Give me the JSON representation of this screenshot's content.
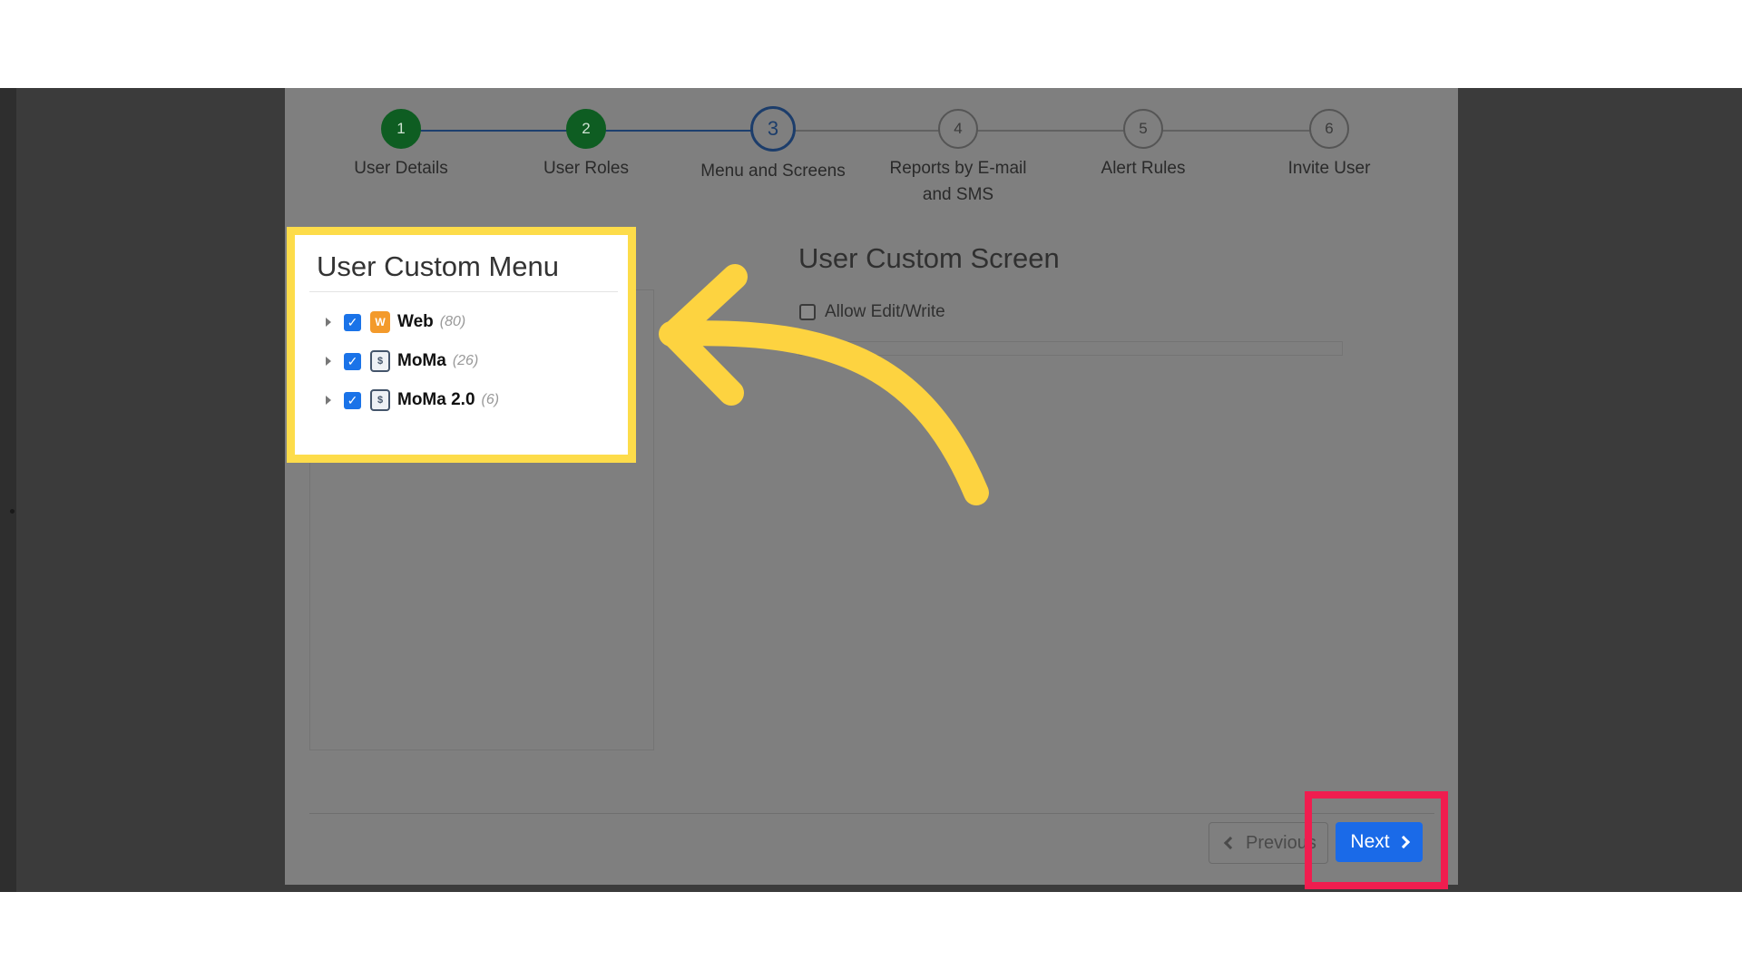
{
  "stepper": {
    "steps": [
      {
        "number": "1",
        "label": "User Details",
        "state": "done"
      },
      {
        "number": "2",
        "label": "User Roles",
        "state": "done"
      },
      {
        "number": "3",
        "label": "Menu and Screens",
        "state": "active"
      },
      {
        "number": "4",
        "label": "Reports by E-mail and SMS",
        "state": "pending"
      },
      {
        "number": "5",
        "label": "Alert Rules",
        "state": "pending"
      },
      {
        "number": "6",
        "label": "Invite User",
        "state": "pending"
      }
    ]
  },
  "menu": {
    "title": "User Custom Menu",
    "items": [
      {
        "name": "Web",
        "count": "(80)",
        "checked": true,
        "icon": "web-app-icon"
      },
      {
        "name": "MoMa",
        "count": "(26)",
        "checked": true,
        "icon": "mobile-app-icon"
      },
      {
        "name": "MoMa 2.0",
        "count": "(6)",
        "checked": true,
        "icon": "mobile-app-icon"
      }
    ]
  },
  "screen": {
    "title": "User Custom Screen",
    "allow_label": "Allow Edit/Write",
    "allow_checked": false
  },
  "footer": {
    "previous_label": "Previous",
    "next_label": "Next"
  },
  "colors": {
    "overlay_dialog": "#7f7f7f",
    "step_done": "#0e5d22",
    "step_active": "#1c3d6b",
    "checkbox": "#1a73e8",
    "next_button": "#1a6ae8",
    "highlight_yellow": "#fddc4a",
    "highlight_red": "#f01d4f",
    "arrow": "#fdd340"
  }
}
